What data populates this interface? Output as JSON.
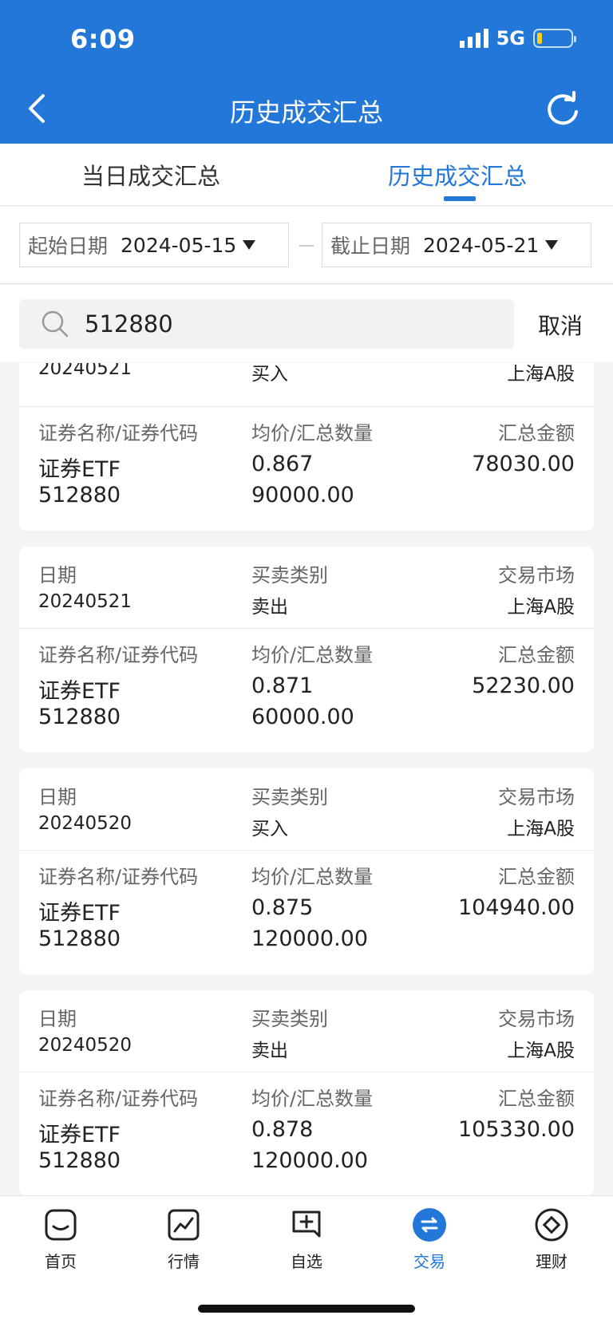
{
  "status_bar": {
    "time": "6:09",
    "network": "5G",
    "battery_percent": 15
  },
  "header": {
    "title": "历史成交汇总"
  },
  "tabs": [
    {
      "label": "当日成交汇总",
      "active": false
    },
    {
      "label": "历史成交汇总",
      "active": true
    }
  ],
  "filters": {
    "start_label": "起始日期",
    "start_value": "2024-05-15",
    "end_label": "截止日期",
    "end_value": "2024-05-21"
  },
  "search": {
    "value": "512880",
    "cancel_label": "取消"
  },
  "labels": {
    "date": "日期",
    "side": "买卖类别",
    "market": "交易市场",
    "security": "证券名称/证券代码",
    "price_qty": "均价/汇总数量",
    "amount": "汇总金额"
  },
  "records": [
    {
      "date": "20240521",
      "side": "买入",
      "market": "上海A股",
      "name": "证券ETF",
      "code": "512880",
      "avg_price": "0.867",
      "quantity": "90000.00",
      "amount": "78030.00"
    },
    {
      "date": "20240521",
      "side": "卖出",
      "market": "上海A股",
      "name": "证券ETF",
      "code": "512880",
      "avg_price": "0.871",
      "quantity": "60000.00",
      "amount": "52230.00"
    },
    {
      "date": "20240520",
      "side": "买入",
      "market": "上海A股",
      "name": "证券ETF",
      "code": "512880",
      "avg_price": "0.875",
      "quantity": "120000.00",
      "amount": "104940.00"
    },
    {
      "date": "20240520",
      "side": "卖出",
      "market": "上海A股",
      "name": "证券ETF",
      "code": "512880",
      "avg_price": "0.878",
      "quantity": "120000.00",
      "amount": "105330.00"
    }
  ],
  "bottom_nav": [
    {
      "label": "首页",
      "icon": "home-icon",
      "active": false
    },
    {
      "label": "行情",
      "icon": "market-chart-icon",
      "active": false
    },
    {
      "label": "自选",
      "icon": "watchlist-add-icon",
      "active": false
    },
    {
      "label": "交易",
      "icon": "trade-swap-icon",
      "active": true
    },
    {
      "label": "理财",
      "icon": "wealth-icon",
      "active": false
    }
  ],
  "colors": {
    "primary": "#2377d9",
    "background": "#f3f4f6"
  }
}
